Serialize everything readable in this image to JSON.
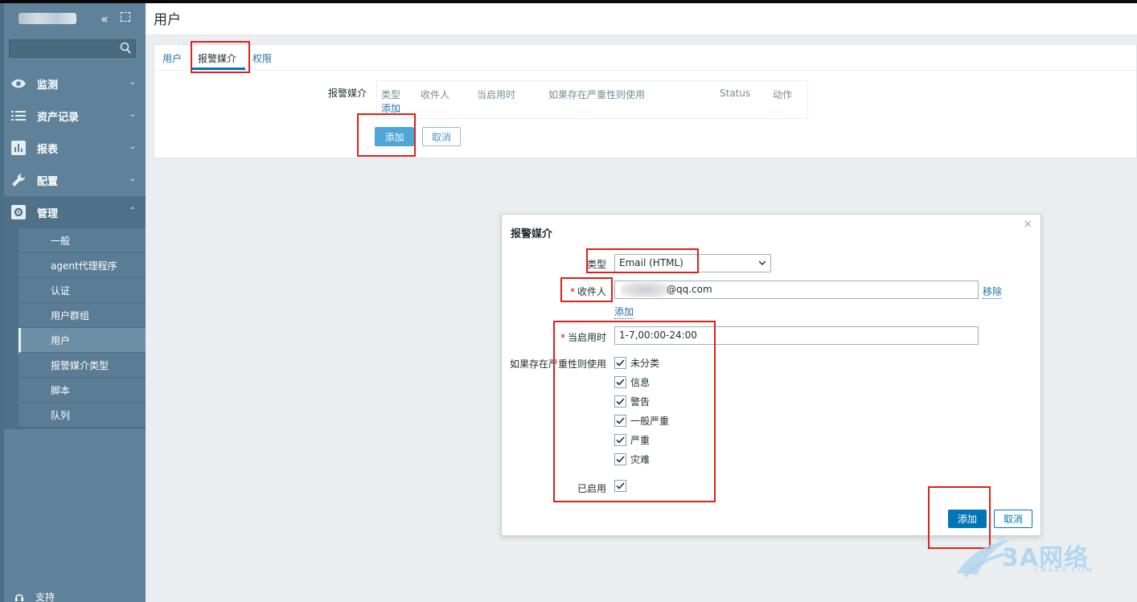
{
  "sidebar": {
    "menu": [
      {
        "label": "监测",
        "icon": "eye-icon"
      },
      {
        "label": "资产记录",
        "icon": "list-icon"
      },
      {
        "label": "报表",
        "icon": "bar-chart-icon"
      },
      {
        "label": "配置",
        "icon": "wrench-icon"
      },
      {
        "label": "管理",
        "icon": "gear-icon"
      }
    ],
    "submenu": [
      {
        "label": "一般"
      },
      {
        "label": "agent代理程序"
      },
      {
        "label": "认证"
      },
      {
        "label": "用户群组"
      },
      {
        "label": "用户",
        "active": true
      },
      {
        "label": "报警媒介类型"
      },
      {
        "label": "脚本"
      },
      {
        "label": "队列"
      }
    ],
    "support_label": "支持"
  },
  "page": {
    "title": "用户",
    "tabs": [
      {
        "label": "用户"
      },
      {
        "label": "报警媒介",
        "active": true
      },
      {
        "label": "权限"
      }
    ],
    "media_label": "报警媒介",
    "media_table": {
      "headers": [
        "类型",
        "收件人",
        "当启用时",
        "如果存在严重性则使用",
        "Status",
        "动作"
      ],
      "add_link": "添加"
    },
    "add_button": "添加",
    "cancel_button": "取消"
  },
  "dialog": {
    "title": "报警媒介",
    "close": "×",
    "type_label": "类型",
    "type_value": "Email (HTML)",
    "recipient_label": "收件人",
    "recipient_required": "*",
    "recipient_value_suffix": "@qq.com",
    "remove_link": "移除",
    "add_link": "添加",
    "when_active_label": "当启用时",
    "when_active_required": "*",
    "when_active_value": "1-7,00:00-24:00",
    "severity_label": "如果存在严重性则使用",
    "severities": [
      {
        "label": "未分类",
        "checked": true
      },
      {
        "label": "信息",
        "checked": true
      },
      {
        "label": "警告",
        "checked": true
      },
      {
        "label": "一般严重",
        "checked": true
      },
      {
        "label": "严重",
        "checked": true
      },
      {
        "label": "灾难",
        "checked": true
      }
    ],
    "enabled_label": "已启用",
    "enabled_checked": true,
    "add_button": "添加",
    "cancel_button": "取消"
  },
  "watermark": {
    "text": "3A网络",
    "sub": "CNAAA.COM",
    "mark": "®"
  },
  "colors": {
    "sidebar": "#5f819a",
    "primary": "#0275b8",
    "highlight_box": "#e0201a"
  }
}
